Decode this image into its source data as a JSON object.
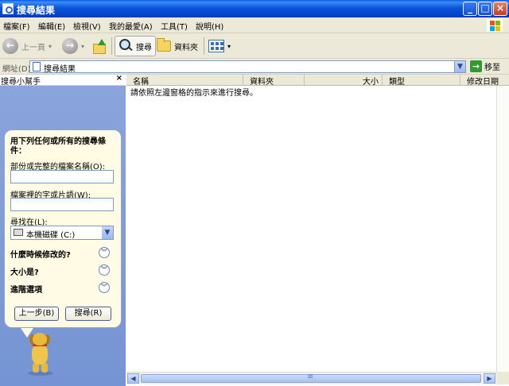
{
  "window": {
    "title": "搜尋結果"
  },
  "menu": [
    "檔案(F)",
    "編輯(E)",
    "檢視(V)",
    "我的最愛(A)",
    "工具(T)",
    "說明(H)"
  ],
  "toolbar": {
    "back_label": "上一頁",
    "search_label": "搜尋",
    "folders_label": "資料夾"
  },
  "address": {
    "label": "網址(D)",
    "value": "搜尋結果",
    "go_label": "移至"
  },
  "search_pane": {
    "title": "搜尋小幫手",
    "close_glyph": "×",
    "heading": "用下列任何或所有的搜尋條件：",
    "name_label": "部份或完整的檔案名稱(O):",
    "phrase_label": "檔案裡的字或片語(W):",
    "look_in_label": "尋找在(L):",
    "look_in_value": "本機磁碟 (C:)",
    "when_label": "什麼時候修改的?",
    "size_label": "大小是?",
    "advanced_label": "進階選項",
    "back_button": "上一步(B)",
    "search_button": "搜尋(R)"
  },
  "list": {
    "columns": [
      "名稱",
      "資料夾",
      "大小",
      "類型",
      "修改日期"
    ],
    "hint": "請依照左邊窗格的指示來進行搜尋。"
  }
}
